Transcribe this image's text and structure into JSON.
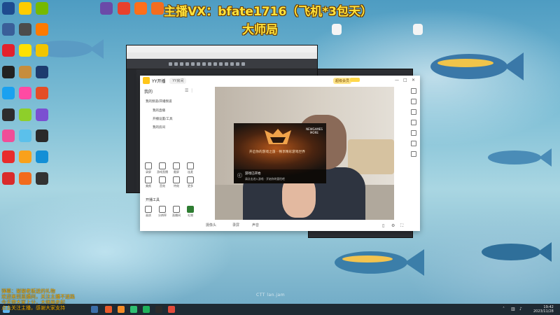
{
  "overlay": {
    "line1": "主播VX：bfate1716（飞机*3包天）",
    "line2": "大师局"
  },
  "yy_window": {
    "app_name": "YY开播",
    "room_label": "YY房间",
    "vip_label": "超级会员",
    "sidebar_title": "我的",
    "list_items": [
      "我的频道/开播频道",
      "我的直播",
      "开播设置/工具",
      "我的房间"
    ],
    "tools_row1": [
      "录屏",
      "游戏直播",
      "截屏",
      "连麦"
    ],
    "tools_row2": [
      "美颜",
      "音效",
      "特效",
      "更多"
    ],
    "section_title": "开播工具",
    "tools_row3": [
      "画质",
      "分辨率",
      "直播间",
      "礼物"
    ],
    "bottom_tabs": [
      "摄像头",
      "录屏",
      "声音"
    ],
    "window_controls": [
      "—",
      "□",
      "✕"
    ]
  },
  "popup": {
    "brand": "NEWGAMES MORE",
    "headline": "开启你的游戏之旅 · 畅享精彩游戏世界",
    "title": "游戏已开始",
    "subtitle": "请点击进入游戏 · 开始你的冒险吧"
  },
  "watermark": "CTT lan.jam",
  "danmaku": [
    "弹幕：谢谢老板送的礼物",
    "欢迎来到直播间，关注主播不迷路",
    "今天带大家上分，大师局走起",
    "点击关注主播，感谢大家支持"
  ],
  "taskbar": {
    "time": "19:42",
    "date": "2023/11/28"
  },
  "colors": {
    "overlay_text": "#ffe23a",
    "yy_brand": "#ffc61a",
    "danmaku": "#ffb400"
  }
}
